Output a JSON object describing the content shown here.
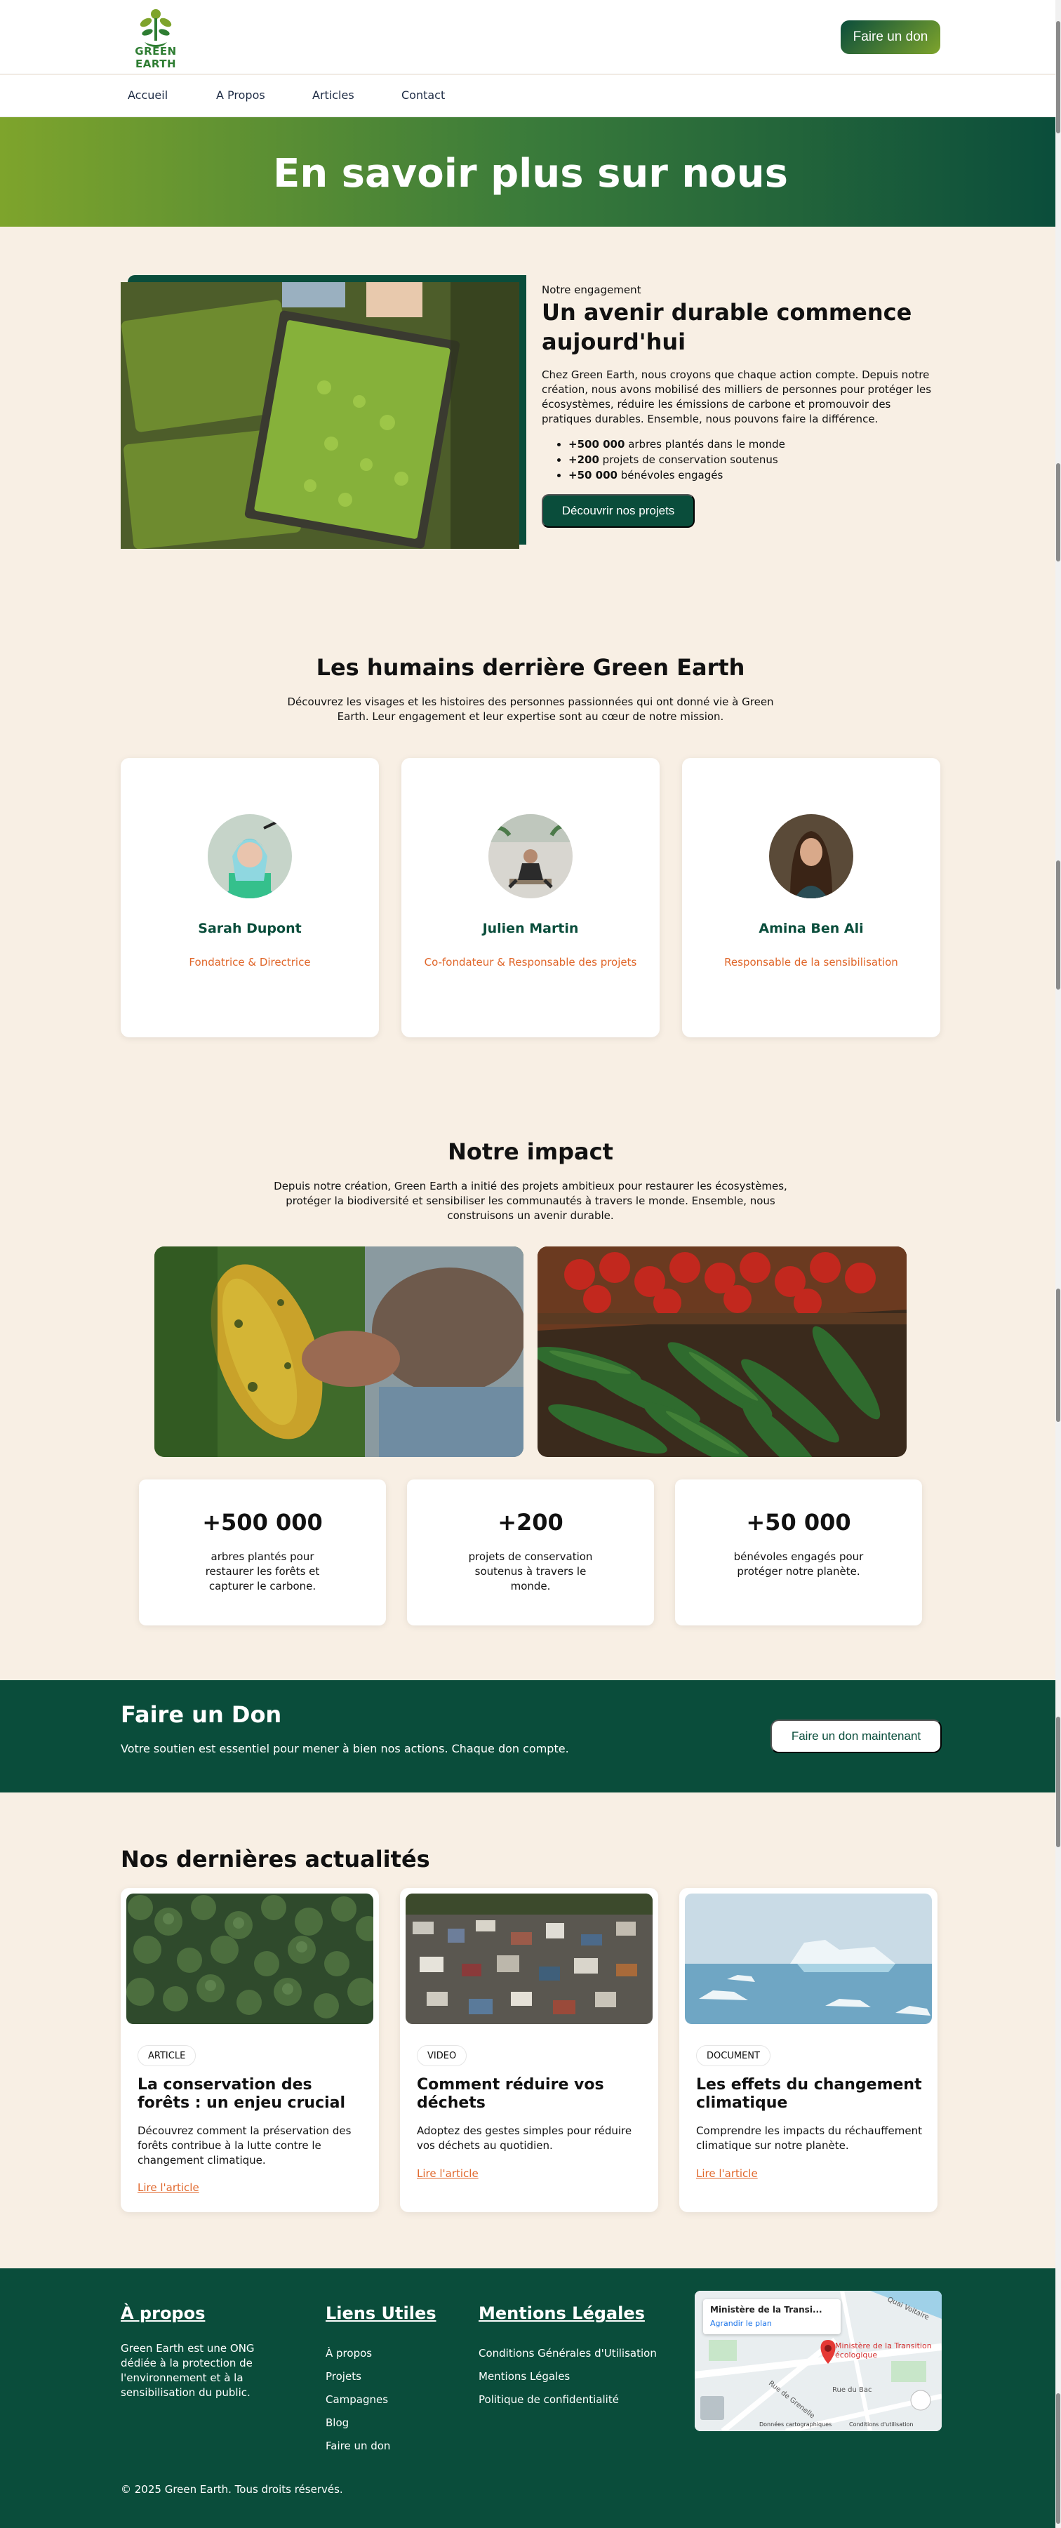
{
  "brand": {
    "name": "GREEN EARTH",
    "primary": "#0a4d3b",
    "accent": "#7ea42c",
    "orange": "#e0672b",
    "background": "#f8efe4"
  },
  "header": {
    "donate_label": "Faire un don"
  },
  "nav": {
    "items": [
      {
        "label": "Accueil"
      },
      {
        "label": "A Propos"
      },
      {
        "label": "Articles"
      },
      {
        "label": "Contact"
      }
    ]
  },
  "hero": {
    "title": "En savoir plus sur nous"
  },
  "engagement": {
    "kicker": "Notre engagement",
    "title": "Un avenir durable commence aujourd'hui",
    "text": "Chez Green Earth, nous croyons que chaque action compte. Depuis notre création, nous avons mobilisé des milliers de personnes pour protéger les écosystèmes, réduire les émissions de carbone et promouvoir des pratiques durables. Ensemble, nous pouvons faire la différence.",
    "bullets": [
      {
        "bold": "+500 000",
        "text": "arbres plantés dans le monde"
      },
      {
        "bold": "+200",
        "text": "projets de conservation soutenus"
      },
      {
        "bold": "+50 000",
        "text": "bénévoles engagés"
      }
    ],
    "button": "Découvrir nos projets"
  },
  "team": {
    "title": "Les humains derrière Green Earth",
    "subtitle": "Découvrez les visages et les histoires des personnes passionnées qui ont donné vie à Green Earth. Leur engagement et leur expertise sont au cœur de notre mission.",
    "members": [
      {
        "name": "Sarah Dupont",
        "role": "Fondatrice & Directrice"
      },
      {
        "name": "Julien Martin",
        "role": "Co-fondateur & Responsable des projets"
      },
      {
        "name": "Amina Ben Ali",
        "role": "Responsable de la sensibilisation"
      }
    ]
  },
  "impact": {
    "title": "Notre impact",
    "subtitle": "Depuis notre création, Green Earth a initié des projets ambitieux pour restaurer les écosystèmes, protéger la biodiversité et sensibiliser les communautés à travers le monde. Ensemble, nous construisons un avenir durable.",
    "stats": [
      {
        "value": "+500 000",
        "label": "arbres plantés pour restaurer les forêts et capturer le carbone."
      },
      {
        "value": "+200",
        "label": "projets de conservation soutenus à travers le monde."
      },
      {
        "value": "+50 000",
        "label": "bénévoles engagés pour protéger notre planète."
      }
    ]
  },
  "donate": {
    "title": "Faire un Don",
    "text": "Votre soutien est essentiel pour mener à bien nos actions. Chaque don compte.",
    "button": "Faire un don maintenant"
  },
  "news": {
    "title": "Nos dernières actualités",
    "articles": [
      {
        "tag": "ARTICLE",
        "title": "La conservation des forêts : un enjeu crucial",
        "desc": "Découvrez comment la préservation des forêts contribue à la lutte contre le changement climatique.",
        "link": "Lire l'article"
      },
      {
        "tag": "VIDEO",
        "title": "Comment réduire vos déchets",
        "desc": "Adoptez des gestes simples pour réduire vos déchets au quotidien.",
        "link": "Lire l'article"
      },
      {
        "tag": "DOCUMENT",
        "title": "Les effets du changement climatique",
        "desc": "Comprendre les impacts du réchauffement climatique sur notre planète.",
        "link": "Lire l'article"
      }
    ]
  },
  "footer": {
    "about_title": "À propos",
    "about_text": "Green Earth est une ONG dédiée à la protection de l'environnement et à la sensibilisation du public.",
    "links_title": "Liens Utiles",
    "links": [
      "À propos",
      "Projets",
      "Campagnes",
      "Blog",
      "Faire un don"
    ],
    "legal_title": "Mentions Légales",
    "legal": [
      "Conditions Générales d'Utilisation",
      "Mentions Légales",
      "Politique de confidentialité"
    ],
    "map": {
      "place": "Ministère de la Transi...",
      "enlarge": "Agrandir le plan",
      "pin_label": "Ministère de la Transition écologique",
      "streets": [
        "Quai Voltaire",
        "Rue du Bac",
        "Rue de Grenelle"
      ],
      "attribution": [
        "Données cartographiques",
        "Conditions d'utilisation"
      ]
    },
    "copyright": "© 2025 Green Earth. Tous droits réservés."
  }
}
